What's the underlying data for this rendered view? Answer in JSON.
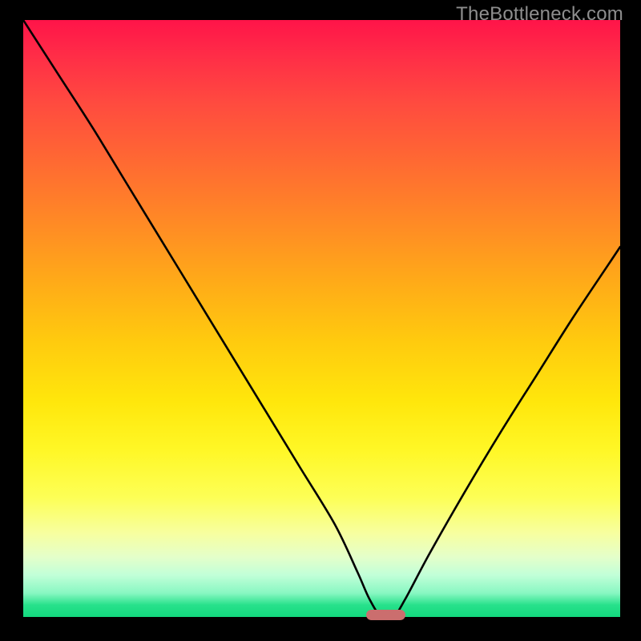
{
  "watermark": "TheBottleneck.com",
  "chart_data": {
    "type": "line",
    "title": "",
    "xlabel": "",
    "ylabel": "",
    "xlim": [
      0,
      100
    ],
    "ylim": [
      0,
      100
    ],
    "grid": false,
    "background_gradient": {
      "top": "#ff1449",
      "upper_mid": "#ffab18",
      "mid": "#ffe70c",
      "lower_mid": "#f7ffa0",
      "bottom": "#13d97e"
    },
    "series": [
      {
        "name": "bottleneck-curve",
        "color": "#000000",
        "x": [
          0.0,
          5.8,
          11.6,
          17.4,
          23.2,
          29.0,
          34.8,
          40.6,
          46.4,
          52.2,
          56.0,
          58.0,
          60.0,
          62.0,
          64.0,
          68.0,
          74.0,
          80.0,
          86.0,
          92.0,
          98.0,
          100.0
        ],
        "values": [
          100.0,
          91.0,
          82.0,
          72.5,
          63.0,
          53.5,
          44.0,
          34.5,
          25.0,
          15.5,
          7.5,
          3.0,
          0.0,
          0.0,
          3.0,
          10.5,
          21.0,
          31.0,
          40.5,
          50.0,
          59.0,
          62.0
        ]
      }
    ],
    "marker": {
      "name": "optimal-range",
      "color": "#cb6e6e",
      "x_start": 57.5,
      "x_end": 64.0,
      "y": 0.0
    }
  }
}
